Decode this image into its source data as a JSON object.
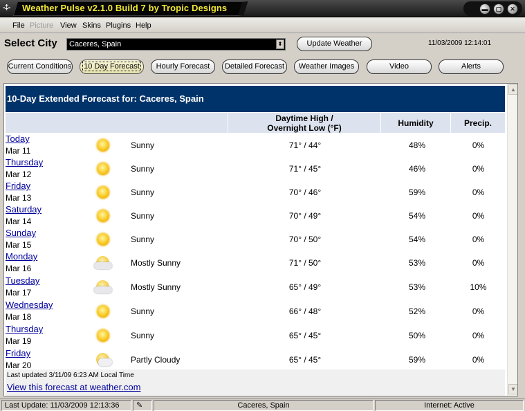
{
  "window": {
    "title": "Weather Pulse v2.1.0 Build 7 by Tropic Designs",
    "app_icon": "plane-icon",
    "controls": [
      "minimize-icon",
      "maximize-icon",
      "close-icon"
    ]
  },
  "menu": {
    "items": [
      {
        "label": "File",
        "enabled": true
      },
      {
        "label": "Picture",
        "enabled": false
      },
      {
        "label": "View",
        "enabled": true
      },
      {
        "label": "Skins",
        "enabled": true
      },
      {
        "label": "Plugins",
        "enabled": true
      },
      {
        "label": "Help",
        "enabled": true
      }
    ]
  },
  "city_bar": {
    "label": "Select City",
    "selected_city": "Caceres, Spain",
    "update_button": "Update Weather",
    "datetime": "11/03/2009 12:14:01"
  },
  "tabs": [
    {
      "label": "Current Conditions",
      "active": false
    },
    {
      "label": "10 Day Forecast",
      "active": true
    },
    {
      "label": "Hourly Forecast",
      "active": false
    },
    {
      "label": "Detailed Forecast",
      "active": false
    },
    {
      "label": "Weather Images",
      "active": false
    },
    {
      "label": "Video",
      "active": false
    },
    {
      "label": "Alerts",
      "active": false
    }
  ],
  "forecast": {
    "heading": "10-Day Extended Forecast for: Caceres, Spain",
    "columns": {
      "temp_line1": "Daytime High /",
      "temp_line2": "Overnight Low (°F)",
      "humidity": "Humidity",
      "precip": "Precip."
    },
    "rows": [
      {
        "day": "Today",
        "date": "Mar 11",
        "icon": "sunny-icon",
        "condition": "Sunny",
        "temp": "71° / 44°",
        "humidity": "48%",
        "precip": "0%"
      },
      {
        "day": "Thursday",
        "date": "Mar 12",
        "icon": "sunny-icon",
        "condition": "Sunny",
        "temp": "71° / 45°",
        "humidity": "46%",
        "precip": "0%"
      },
      {
        "day": "Friday",
        "date": "Mar 13",
        "icon": "sunny-icon",
        "condition": "Sunny",
        "temp": "70° / 46°",
        "humidity": "59%",
        "precip": "0%"
      },
      {
        "day": "Saturday",
        "date": "Mar 14",
        "icon": "sunny-icon",
        "condition": "Sunny",
        "temp": "70° / 49°",
        "humidity": "54%",
        "precip": "0%"
      },
      {
        "day": "Sunday",
        "date": "Mar 15",
        "icon": "sunny-icon",
        "condition": "Sunny",
        "temp": "70° / 50°",
        "humidity": "54%",
        "precip": "0%"
      },
      {
        "day": "Monday",
        "date": "Mar 16",
        "icon": "mostly-sunny-icon",
        "condition": "Mostly Sunny",
        "temp": "71° / 50°",
        "humidity": "53%",
        "precip": "0%"
      },
      {
        "day": "Tuesday",
        "date": "Mar 17",
        "icon": "mostly-sunny-icon",
        "condition": "Mostly Sunny",
        "temp": "65° / 49°",
        "humidity": "53%",
        "precip": "10%"
      },
      {
        "day": "Wednesday",
        "date": "Mar 18",
        "icon": "sunny-icon",
        "condition": "Sunny",
        "temp": "66° / 48°",
        "humidity": "52%",
        "precip": "0%"
      },
      {
        "day": "Thursday",
        "date": "Mar 19",
        "icon": "sunny-icon",
        "condition": "Sunny",
        "temp": "65° / 45°",
        "humidity": "50%",
        "precip": "0%"
      },
      {
        "day": "Friday",
        "date": "Mar 20",
        "icon": "partly-cloudy-icon",
        "condition": "Partly Cloudy",
        "temp": "65° / 45°",
        "humidity": "59%",
        "precip": "0%"
      }
    ],
    "last_updated": "Last updated 3/11/09 6:23 AM Local Time",
    "link_text": "View this forecast at weather.com"
  },
  "statusbar": {
    "last_update": "Last Update: 11/03/2009 12:13:36",
    "city": "Caceres, Spain",
    "internet": "Internet: Active"
  }
}
